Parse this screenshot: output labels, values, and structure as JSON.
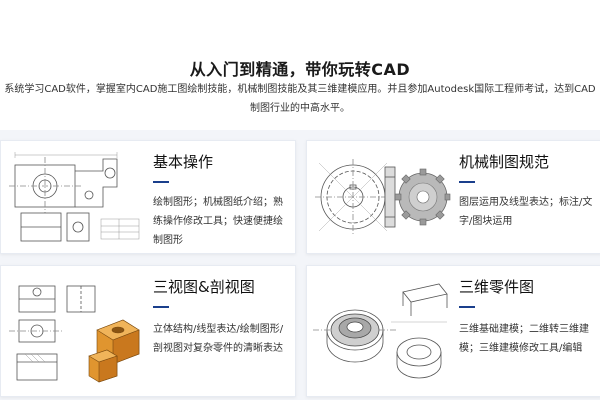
{
  "header": {
    "headline": "从入门到精通，带你玩转CAD",
    "intro": "系统学习CAD软件，掌握室内CAD施工图绘制技能，机械制图技能及其三维建模应用。并且参加Autodesk国际工程师考试，达到CAD制图行业的中高水平。"
  },
  "accent_color": "#1a3f8c",
  "cards": [
    {
      "title": "基本操作",
      "desc": "绘制图形；机械图纸介绍；熟练操作修改工具；快速便捷绘制图形",
      "image": "mechanical-bracket-drawing"
    },
    {
      "title": "机械制图规范",
      "desc": "图层运用及线型表达；标注/文字/图块运用",
      "image": "gear-drawing"
    },
    {
      "title": "三视图&剖视图",
      "desc": "立体结构/线型表达/绘制图形/剖视图对复杂零件的清晰表达",
      "image": "three-view-section-drawing"
    },
    {
      "title": "三维零件图",
      "desc": "三维基础建模；二维转三维建模；三维建模修改工具/编辑",
      "image": "3d-part-drawing"
    }
  ]
}
